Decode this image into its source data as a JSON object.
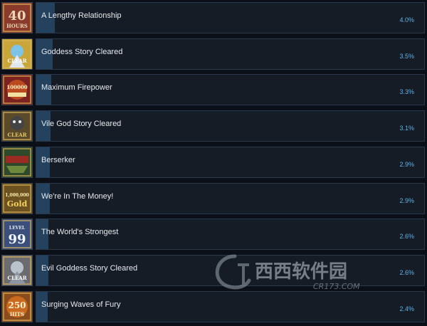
{
  "achievements": [
    {
      "name": "A Lengthy Relationship",
      "percent": "4.0%",
      "fill": 0.04,
      "icon": "forty-hours-icon",
      "icon_color": "#8a3b2c"
    },
    {
      "name": "Goddess Story Cleared",
      "percent": "3.5%",
      "fill": 0.035,
      "icon": "goddess-clear-icon",
      "icon_color": "#c9a53a"
    },
    {
      "name": "Maximum Firepower",
      "percent": "3.3%",
      "fill": 0.033,
      "icon": "hundred-thousand-damage-icon",
      "icon_color": "#7a2320"
    },
    {
      "name": "Vile God Story Cleared",
      "percent": "3.1%",
      "fill": 0.031,
      "icon": "vile-god-clear-icon",
      "icon_color": "#5a4a2a"
    },
    {
      "name": "Berserker",
      "percent": "2.9%",
      "fill": 0.029,
      "icon": "berserker-icon",
      "icon_color": "#2e4a2a"
    },
    {
      "name": "We're In The Money!",
      "percent": "2.9%",
      "fill": 0.029,
      "icon": "gold-icon",
      "icon_color": "#6b5220"
    },
    {
      "name": "The World's Strongest",
      "percent": "2.6%",
      "fill": 0.026,
      "icon": "level-99-icon",
      "icon_color": "#3b4f7a"
    },
    {
      "name": "Evil Goddess Story Cleared",
      "percent": "2.6%",
      "fill": 0.026,
      "icon": "evil-goddess-clear-icon",
      "icon_color": "#6c6c70"
    },
    {
      "name": "Surging Waves of Fury",
      "percent": "2.4%",
      "fill": 0.024,
      "icon": "surging-waves-icon",
      "icon_color": "#8a4b1d"
    }
  ],
  "icon_text": {
    "forty_hours_big": "40",
    "forty_hours_small": "HOURS",
    "damage_number": "100000",
    "gold_number": "1,000,000",
    "gold_word": "Gold",
    "level_word": "LEVEL",
    "level_number": "99",
    "clear_word": "CLEAR",
    "hits_number": "250",
    "hits_word": "HITS"
  },
  "watermark": {
    "brand": "西西软件园",
    "url": "CR173.COM"
  },
  "colors": {
    "background": "#0b1018",
    "bar_bg": "#161c26",
    "bar_fill": "#24425e",
    "percent_text": "#5fb3e8",
    "name_text": "#e6eaee"
  }
}
